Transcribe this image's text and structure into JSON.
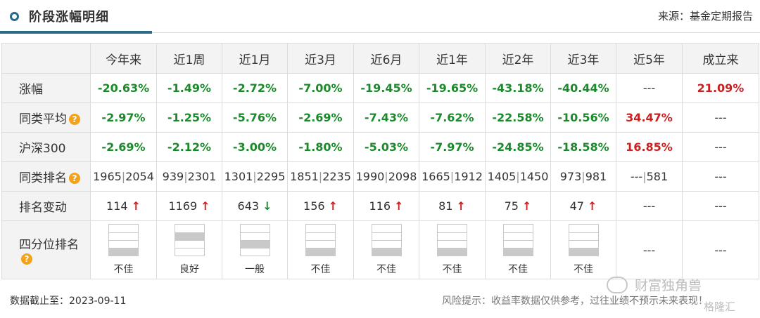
{
  "header": {
    "title": "阶段涨幅明细",
    "source": "来源：基金定期报告"
  },
  "columns": [
    "今年来",
    "近1周",
    "近1月",
    "近3月",
    "近6月",
    "近1年",
    "近2年",
    "近3年",
    "近5年",
    "成立来"
  ],
  "rows": {
    "return": {
      "label": "涨幅",
      "values": [
        "-20.63%",
        "-1.49%",
        "-2.72%",
        "-7.00%",
        "-19.45%",
        "-19.65%",
        "-43.18%",
        "-40.44%",
        "---",
        "21.09%"
      ]
    },
    "peer_avg": {
      "label": "同类平均",
      "values": [
        "-2.97%",
        "-1.25%",
        "-5.76%",
        "-2.69%",
        "-7.43%",
        "-7.62%",
        "-22.58%",
        "-10.56%",
        "34.47%",
        "---"
      ]
    },
    "hs300": {
      "label": "沪深300",
      "values": [
        "-2.69%",
        "-2.12%",
        "-3.00%",
        "-1.80%",
        "-5.03%",
        "-7.97%",
        "-24.85%",
        "-18.58%",
        "16.85%",
        "---"
      ]
    },
    "peer_rank": {
      "label": "同类排名",
      "ranks": [
        "1965",
        "939",
        "1301",
        "1851",
        "1990",
        "1665",
        "1405",
        "973",
        "---",
        ""
      ],
      "totals": [
        "2054",
        "2301",
        "2295",
        "2235",
        "2098",
        "1912",
        "1450",
        "981",
        "581",
        ""
      ],
      "last": "---"
    },
    "rank_change": {
      "label": "排名变动",
      "values": [
        "114",
        "1169",
        "643",
        "156",
        "116",
        "81",
        "75",
        "47",
        "---",
        "---"
      ],
      "directions": [
        "up",
        "up",
        "down",
        "up",
        "up",
        "up",
        "up",
        "up",
        "",
        ""
      ]
    },
    "quartile": {
      "label": "四分位排名",
      "labels": [
        "不佳",
        "良好",
        "一般",
        "不佳",
        "不佳",
        "不佳",
        "不佳",
        "不佳",
        "---",
        "---"
      ],
      "filled_quartile": [
        4,
        2,
        3,
        4,
        4,
        4,
        4,
        4,
        0,
        0
      ]
    }
  },
  "footer": {
    "date": "数据截止至：2023-09-11",
    "risk": "风险提示：收益率数据仅供参考，过往业绩不预示未来表现！"
  },
  "watermark": {
    "name": "财富独角兽",
    "brand": "格隆汇"
  },
  "icons": {
    "title_bullet": "circle-icon",
    "help": "question-icon"
  },
  "colors": {
    "negative": "#1a8a2a",
    "positive": "#cc1f1f",
    "accent": "#2a6a86",
    "help": "#f3a21a"
  }
}
